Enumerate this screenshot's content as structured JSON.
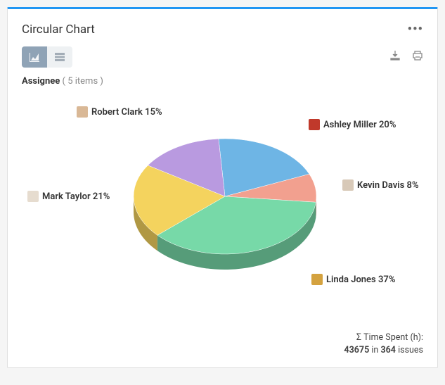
{
  "header": {
    "title": "Circular Chart"
  },
  "group": {
    "label": "Assignee",
    "count_text": "( 5 items )"
  },
  "footer": {
    "label": "Σ Time Spent (h):",
    "value": "43675",
    "mid": "in",
    "issues": "364",
    "suffix": "issues"
  },
  "chart_data": {
    "type": "pie",
    "title": "Circular Chart",
    "series": [
      {
        "name": "Ashley Miller",
        "value": 20,
        "color": "#6eb5e5",
        "avatar": "#c0392b"
      },
      {
        "name": "Kevin Davis",
        "value": 8,
        "color": "#f2a08f",
        "avatar": "#d8c9b8"
      },
      {
        "name": "Linda Jones",
        "value": 37,
        "color": "#77d9a8",
        "avatar": "#d4a23f"
      },
      {
        "name": "Mark Taylor",
        "value": 21,
        "color": "#f4d35e",
        "avatar": "#e6dccf"
      },
      {
        "name": "Robert Clark",
        "value": 15,
        "color": "#b99ae0",
        "avatar": "#d9b896"
      }
    ],
    "labels": {
      "ashley": "Ashley Miller 20%",
      "kevin": "Kevin Davis 8%",
      "linda": "Linda Jones 37%",
      "mark": "Mark Taylor 21%",
      "robert": "Robert Clark 15%"
    }
  }
}
